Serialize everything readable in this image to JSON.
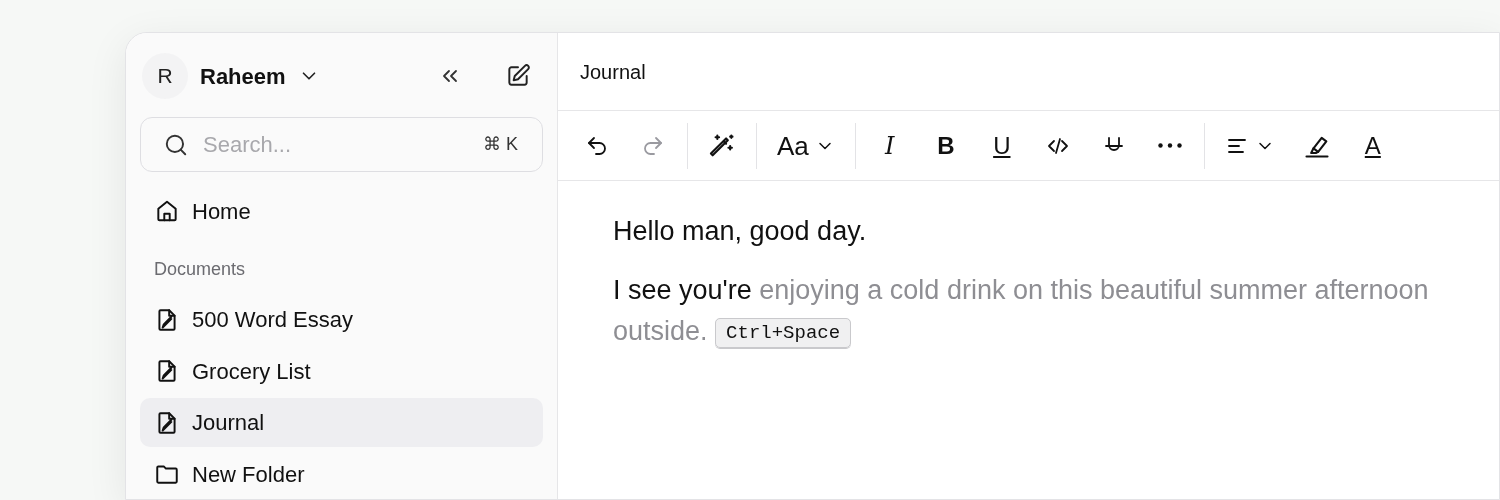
{
  "sidebar": {
    "user": {
      "initial": "R",
      "name": "Raheem"
    },
    "search": {
      "placeholder": "Search...",
      "shortcut": "⌘ K"
    },
    "home": {
      "label": "Home"
    },
    "section_title": "Documents",
    "items": [
      {
        "label": "500 Word Essay",
        "kind": "document",
        "selected": false
      },
      {
        "label": "Grocery List",
        "kind": "document",
        "selected": false
      },
      {
        "label": "Journal",
        "kind": "document",
        "selected": true
      },
      {
        "label": "New Folder",
        "kind": "folder",
        "selected": false
      }
    ]
  },
  "editor": {
    "title": "Journal",
    "toolbar": [
      [
        {
          "kind": "icon",
          "disabled": false
        },
        {
          "kind": "icon",
          "disabled": true
        }
      ],
      [
        {
          "kind": "icon",
          "disabled": false
        }
      ],
      [
        {
          "kind": "text",
          "label": "Aa",
          "dropdown": true,
          "disabled": false
        }
      ],
      [
        {
          "kind": "text",
          "label": "I",
          "disabled": false
        },
        {
          "kind": "text",
          "label": "B",
          "disabled": false
        },
        {
          "kind": "text",
          "label": "U",
          "disabled": false
        },
        {
          "kind": "icon",
          "disabled": false
        },
        {
          "kind": "icon",
          "disabled": false
        },
        {
          "kind": "icon",
          "disabled": false
        }
      ],
      [
        {
          "kind": "icon",
          "dropdown": true,
          "disabled": false
        },
        {
          "kind": "icon",
          "disabled": false
        },
        {
          "kind": "text",
          "label": "A",
          "disabled": false
        }
      ]
    ],
    "paragraphs": [
      {
        "text": "Hello man, good day."
      },
      {
        "text": "I see you're",
        "suggestion": "enjoying a cold drink on this beautiful summer afternoon outside.",
        "shortcut": "Ctrl+Space"
      }
    ]
  }
}
